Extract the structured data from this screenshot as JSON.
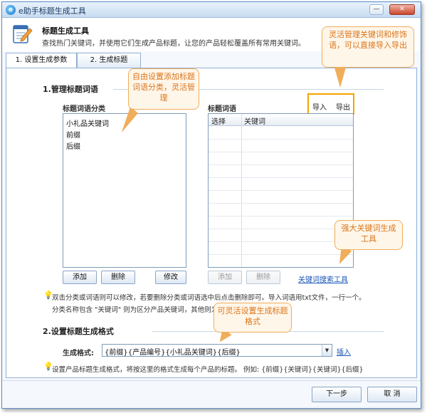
{
  "window": {
    "title": "e助手标题生成工具",
    "app_icon": "e",
    "minimize_label": "—",
    "close_label": "✕"
  },
  "header": {
    "title": "标题生成工具",
    "description": "查找热门关键词，并使用它们生成产品标题，让您的产品轻松覆盖所有常用关键词。"
  },
  "tabs": [
    {
      "label": "1. 设置生成参数",
      "active": true
    },
    {
      "label": "2. 生成标题",
      "active": false
    }
  ],
  "section1": {
    "title": "1.管理标题词语",
    "category_label": "标题词语分类",
    "words_label": "标题词语",
    "import_label": "导入",
    "export_label": "导出",
    "categories": [
      "小礼品关键词",
      "前缀",
      "后缀"
    ],
    "grid_columns": [
      "选择",
      "关键词"
    ],
    "add_cat_label": "添加",
    "del_cat_label": "删除",
    "edit_cat_label": "修改",
    "add_word_label": "添加",
    "del_word_label": "删除",
    "search_tool_label": "关键词搜索工具",
    "tip_line1": "双击分类或词语则可以修改，若要删除分类或词语选中后点击删除即可。导入词语用txt文件，一行一个。",
    "tip_line2": "分类名称包含 \"关键词\" 则为区分产品关键词，其他则为修饰词。"
  },
  "section2": {
    "title": "2.设置标题生成格式",
    "format_label": "生成格式:",
    "format_value": "{前缀}{产品编号}{小礼品关键词}{后缀}",
    "insert_label": "插入",
    "tip": "设置产品标题生成格式，将按这里的格式生成每个产品的标题。 例如: {前缀}{关键词}{关键词}{后缀}"
  },
  "footer": {
    "next_label": "下一步",
    "cancel_label": "取 消"
  },
  "callouts": {
    "c1": "自由设置添加标题词语分类，灵活管理",
    "c2": "灵活管理关键词和修饰语，可以直接导入导出",
    "c3": "强大关键词生成工具",
    "c4": "可灵活设置生成标题格式"
  },
  "colors": {
    "accent": "#1a55b5",
    "callout_border": "#f0ad5a",
    "callout_text": "#d9761a",
    "highlight": "#f4a300"
  }
}
